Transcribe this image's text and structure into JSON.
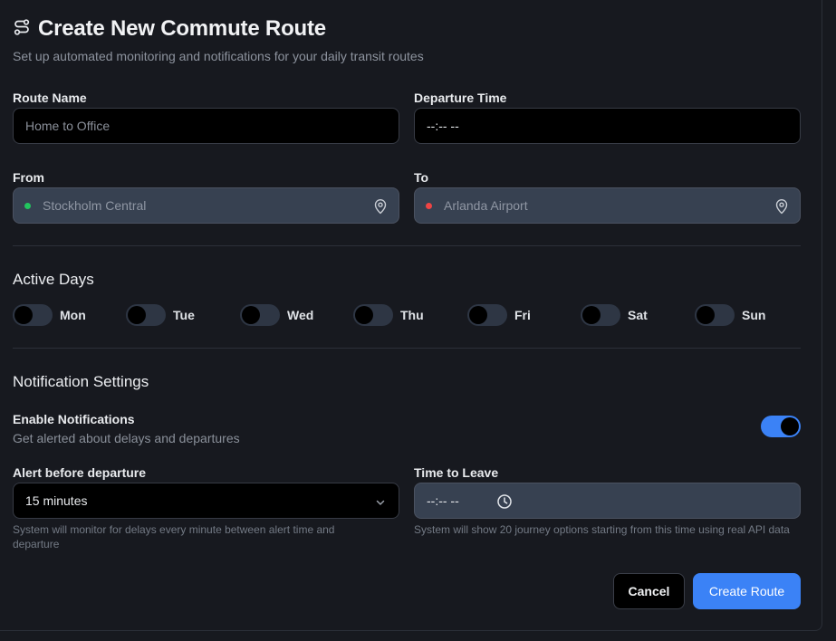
{
  "header": {
    "title": "Create New Commute Route",
    "subtitle": "Set up automated monitoring and notifications for your daily transit routes",
    "icon": "route-icon"
  },
  "form": {
    "route_name": {
      "label": "Route Name",
      "placeholder": "Home to Office",
      "value": ""
    },
    "departure_time": {
      "label": "Departure Time",
      "value": "--:-- --"
    },
    "from": {
      "label": "From",
      "placeholder": "Stockholm Central",
      "dot_color": "#22c55e",
      "icon": "map-pin-icon"
    },
    "to": {
      "label": "To",
      "placeholder": "Arlanda Airport",
      "dot_color": "#ef4444",
      "icon": "map-pin-icon"
    }
  },
  "active_days": {
    "title": "Active Days",
    "days": [
      {
        "label": "Mon",
        "enabled": false
      },
      {
        "label": "Tue",
        "enabled": false
      },
      {
        "label": "Wed",
        "enabled": false
      },
      {
        "label": "Thu",
        "enabled": false
      },
      {
        "label": "Fri",
        "enabled": false
      },
      {
        "label": "Sat",
        "enabled": false
      },
      {
        "label": "Sun",
        "enabled": false
      }
    ]
  },
  "notifications": {
    "title": "Notification Settings",
    "enable_label": "Enable Notifications",
    "enable_sub": "Get alerted about delays and departures",
    "enabled": true,
    "alert_before": {
      "label": "Alert before departure",
      "selected": "15 minutes",
      "help": "System will monitor for delays every minute between alert time and departure"
    },
    "time_to_leave": {
      "label": "Time to Leave",
      "value": "--:-- --",
      "help": "System will show 20 journey options starting from this time using real API data"
    }
  },
  "actions": {
    "cancel": "Cancel",
    "create": "Create Route"
  },
  "colors": {
    "accent": "#3b82f6",
    "background": "#17191f",
    "input_slate": "#374151"
  }
}
